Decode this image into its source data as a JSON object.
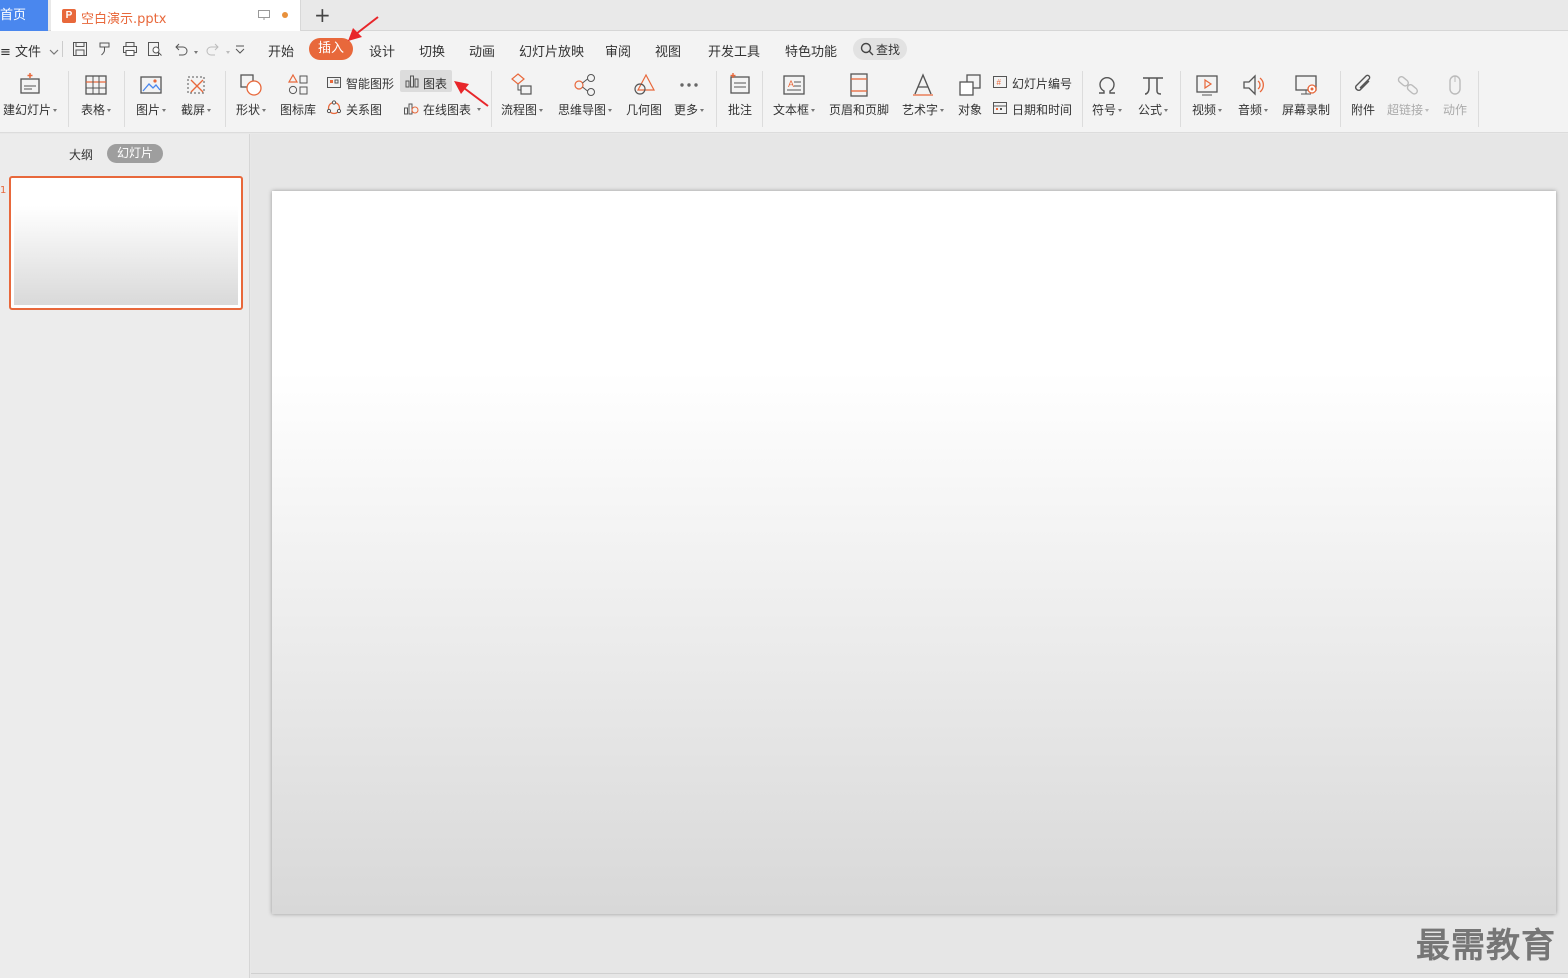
{
  "tabs": {
    "home": "首页",
    "document": "空白演示.pptx",
    "document_icon_letter": "P",
    "add": "+"
  },
  "menu": {
    "file": "文件",
    "tabs": [
      "开始",
      "插入",
      "设计",
      "切换",
      "动画",
      "幻灯片放映",
      "审阅",
      "视图",
      "开发工具",
      "特色功能"
    ],
    "active_tab": "插入",
    "search": "查找"
  },
  "ribbon": {
    "new_slide": "建幻灯片",
    "table": "表格",
    "picture": "图片",
    "screenshot": "截屏",
    "shape": "形状",
    "icon_library": "图标库",
    "smart_art": "智能图形",
    "chart": "图表",
    "relation": "关系图",
    "online_chart": "在线图表",
    "flowchart": "流程图",
    "mindmap": "思维导图",
    "geometry": "几何图",
    "more": "更多",
    "comment": "批注",
    "textbox": "文本框",
    "header_footer": "页眉和页脚",
    "wordart": "艺术字",
    "object": "对象",
    "slide_number": "幻灯片编号",
    "date_time": "日期和时间",
    "symbol": "符号",
    "formula": "公式",
    "video": "视频",
    "audio": "音频",
    "screen_record": "屏幕录制",
    "attachment": "附件",
    "hyperlink": "超链接",
    "action": "动作"
  },
  "panel": {
    "outline": "大纲",
    "slides": "幻灯片",
    "slide_number": "1"
  },
  "watermark": "最需教育",
  "colors": {
    "accent": "#e8683b",
    "home_tab": "#4a87ee",
    "annotation_arrow": "#e8262a"
  }
}
